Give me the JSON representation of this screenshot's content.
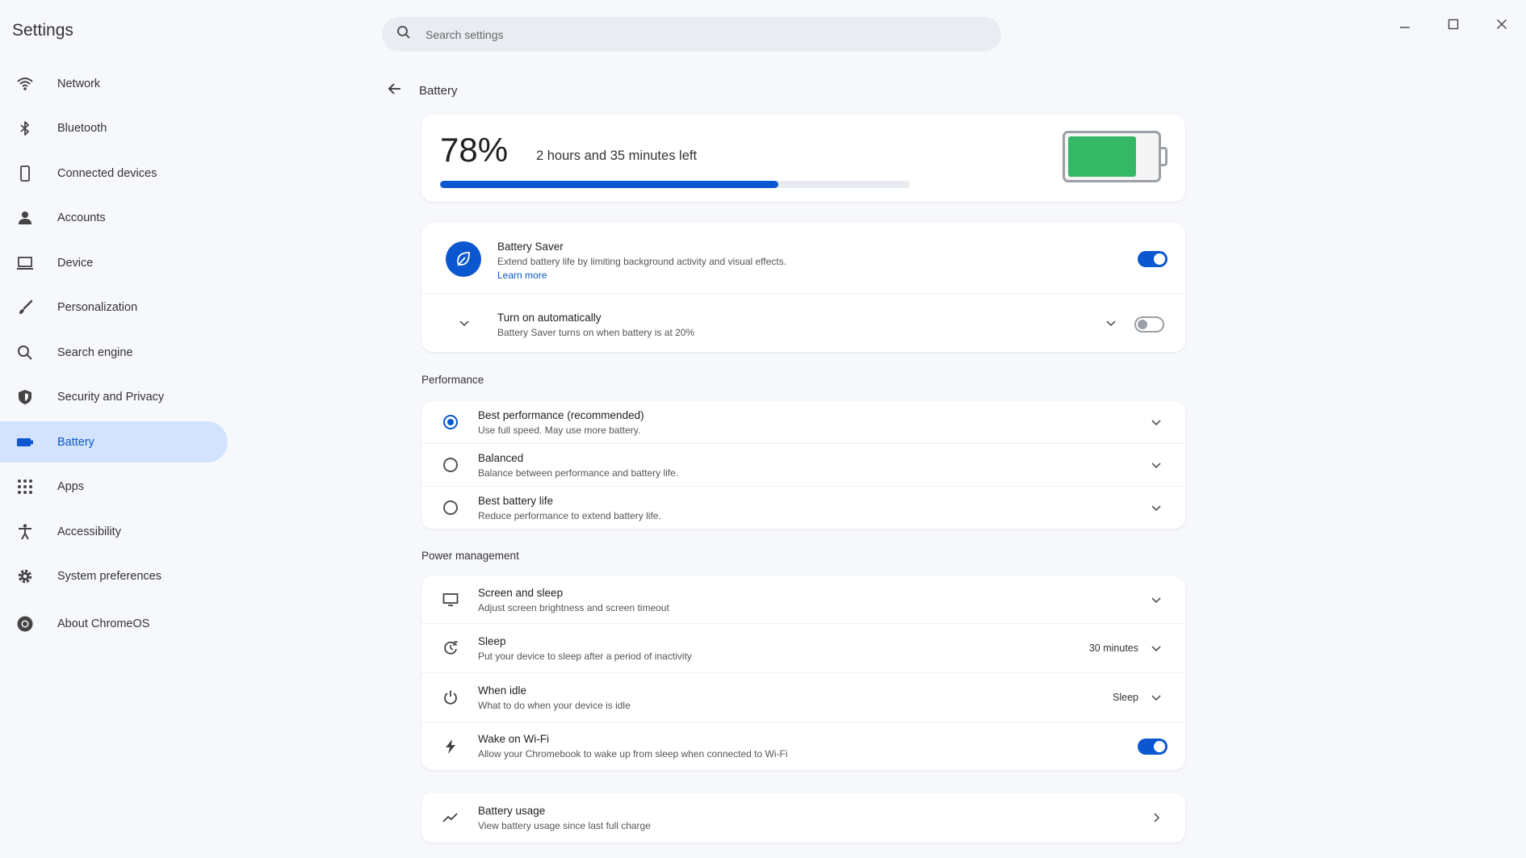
{
  "app": {
    "title": "Settings"
  },
  "search": {
    "placeholder": "Search settings"
  },
  "sidebar": {
    "items": [
      {
        "label": "Network",
        "icon": "wifi-icon"
      },
      {
        "label": "Bluetooth",
        "icon": "bluetooth-icon"
      },
      {
        "label": "Connected devices",
        "icon": "phone-icon"
      },
      {
        "label": "Accounts",
        "icon": "person-icon"
      },
      {
        "label": "Device",
        "icon": "laptop-icon"
      },
      {
        "label": "Personalization",
        "icon": "brush-icon"
      },
      {
        "label": "Search engine",
        "icon": "search-icon"
      },
      {
        "label": "Security and Privacy",
        "icon": "shield-icon"
      },
      {
        "label": "Battery",
        "icon": "battery-icon",
        "active": true
      },
      {
        "label": "Apps",
        "icon": "apps-grid-icon"
      },
      {
        "label": "Accessibility",
        "icon": "accessibility-icon"
      },
      {
        "label": "System preferences",
        "icon": "gear-icon"
      },
      {
        "label": "About ChromeOS",
        "icon": "chrome-icon"
      }
    ]
  },
  "page": {
    "title": "Battery"
  },
  "battery": {
    "percent_label": "78%",
    "percent": 78,
    "time_left": "2 hours and 35 minutes left",
    "progress_fraction": 0.72,
    "fill_color": "#34b866"
  },
  "saver": {
    "title": "Battery Saver",
    "subtitle": "Extend battery life by limiting background activity and visual effects.",
    "link": "Learn more",
    "enabled": true,
    "auto": {
      "title": "Turn on automatically",
      "subtitle": "Battery Saver turns on when battery is at 20%",
      "enabled": false
    }
  },
  "performance": {
    "heading": "Performance",
    "options": [
      {
        "title": "Best performance (recommended)",
        "subtitle": "Use full speed. May use more battery.",
        "selected": true
      },
      {
        "title": "Balanced",
        "subtitle": "Balance between performance and battery life.",
        "selected": false
      },
      {
        "title": "Best battery life",
        "subtitle": "Reduce performance to extend battery life.",
        "selected": false
      }
    ]
  },
  "power": {
    "heading": "Power management",
    "rows": [
      {
        "title": "Screen and sleep",
        "subtitle": "Adjust screen brightness and screen timeout",
        "icon": "monitor-icon"
      },
      {
        "title": "Sleep",
        "subtitle": "Put your device to sleep after a period of inactivity",
        "value": "30 minutes",
        "icon": "sleep-timer-icon"
      },
      {
        "title": "When idle",
        "subtitle": "What to do when your device is idle",
        "value": "Sleep",
        "icon": "power-icon"
      },
      {
        "title": "Wake on Wi-Fi",
        "subtitle": "Allow your Chromebook to wake up from sleep when connected to Wi-Fi",
        "icon": "lightning-icon",
        "enabled": true
      }
    ]
  },
  "usage": {
    "title": "Battery usage",
    "subtitle": "View battery usage since last full charge",
    "icon": "trend-line-icon"
  },
  "colors": {
    "accent": "#0b57d0",
    "active_nav_bg": "#d3e3fd",
    "battery_green": "#34b866",
    "page_bg": "#f6f8fc"
  }
}
